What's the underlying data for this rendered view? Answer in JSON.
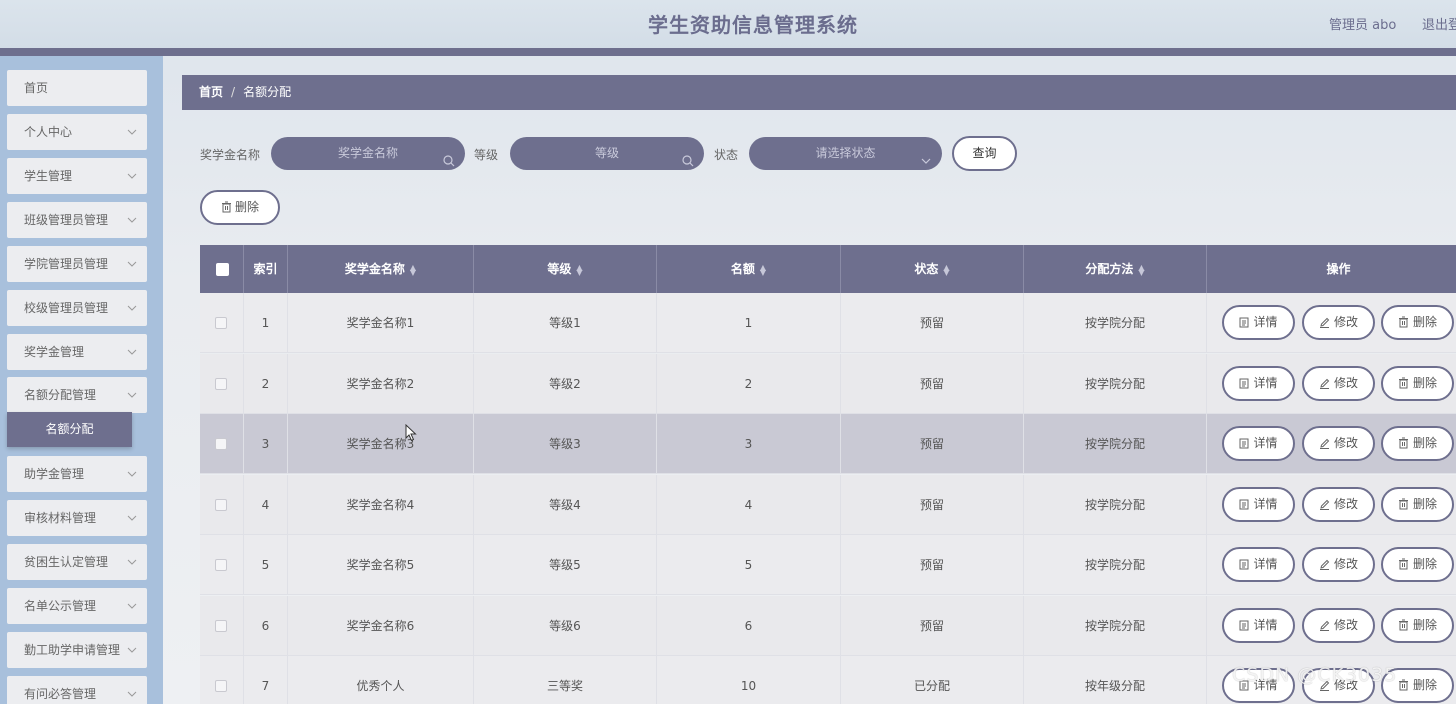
{
  "header": {
    "title": "学生资助信息管理系统",
    "user": "管理员 abo",
    "logout": "退出登"
  },
  "sidebar": {
    "items": [
      {
        "label": "首页",
        "has_chevron": false
      },
      {
        "label": "个人中心",
        "has_chevron": true
      },
      {
        "label": "学生管理",
        "has_chevron": true
      },
      {
        "label": "班级管理员管理",
        "has_chevron": true
      },
      {
        "label": "学院管理员管理",
        "has_chevron": true
      },
      {
        "label": "校级管理员管理",
        "has_chevron": true
      },
      {
        "label": "奖学金管理",
        "has_chevron": true
      },
      {
        "label": "名额分配管理",
        "has_chevron": true
      },
      {
        "label": "助学金管理",
        "has_chevron": true
      },
      {
        "label": "审核材料管理",
        "has_chevron": true
      },
      {
        "label": "贫困生认定管理",
        "has_chevron": true
      },
      {
        "label": "名单公示管理",
        "has_chevron": true
      },
      {
        "label": "勤工助学申请管理",
        "has_chevron": true
      },
      {
        "label": "有问必答管理",
        "has_chevron": true
      }
    ],
    "active_sub": "名额分配"
  },
  "breadcrumb": {
    "home": "首页",
    "separator": "/",
    "current": "名额分配"
  },
  "search": {
    "scholarship_label": "奖学金名称",
    "scholarship_placeholder": "奖学金名称",
    "level_label": "等级",
    "level_placeholder": "等级",
    "status_label": "状态",
    "status_placeholder": "请选择状态",
    "query_button": "查询"
  },
  "toolbar": {
    "delete_button": "删除"
  },
  "table": {
    "headers": {
      "index": "索引",
      "name": "奖学金名称",
      "level": "等级",
      "quota": "名额",
      "status": "状态",
      "method": "分配方法",
      "actions": "操作"
    },
    "action_labels": {
      "detail": "详情",
      "edit": "修改",
      "delete": "删除"
    },
    "rows": [
      {
        "index": "1",
        "name": "奖学金名称1",
        "level": "等级1",
        "quota": "1",
        "status": "预留",
        "method": "按学院分配"
      },
      {
        "index": "2",
        "name": "奖学金名称2",
        "level": "等级2",
        "quota": "2",
        "status": "预留",
        "method": "按学院分配"
      },
      {
        "index": "3",
        "name": "奖学金名称3",
        "level": "等级3",
        "quota": "3",
        "status": "预留",
        "method": "按学院分配"
      },
      {
        "index": "4",
        "name": "奖学金名称4",
        "level": "等级4",
        "quota": "4",
        "status": "预留",
        "method": "按学院分配"
      },
      {
        "index": "5",
        "name": "奖学金名称5",
        "level": "等级5",
        "quota": "5",
        "status": "预留",
        "method": "按学院分配"
      },
      {
        "index": "6",
        "name": "奖学金名称6",
        "level": "等级6",
        "quota": "6",
        "status": "预留",
        "method": "按学院分配"
      },
      {
        "index": "7",
        "name": "优秀个人",
        "level": "三等奖",
        "quota": "10",
        "status": "已分配",
        "method": "按年级分配"
      }
    ],
    "hovered_row": 3
  },
  "watermark": "CSDN @CK3035",
  "colors": {
    "accent": "#6e6f8e",
    "sidebar_bg": "#a8c0dc"
  }
}
